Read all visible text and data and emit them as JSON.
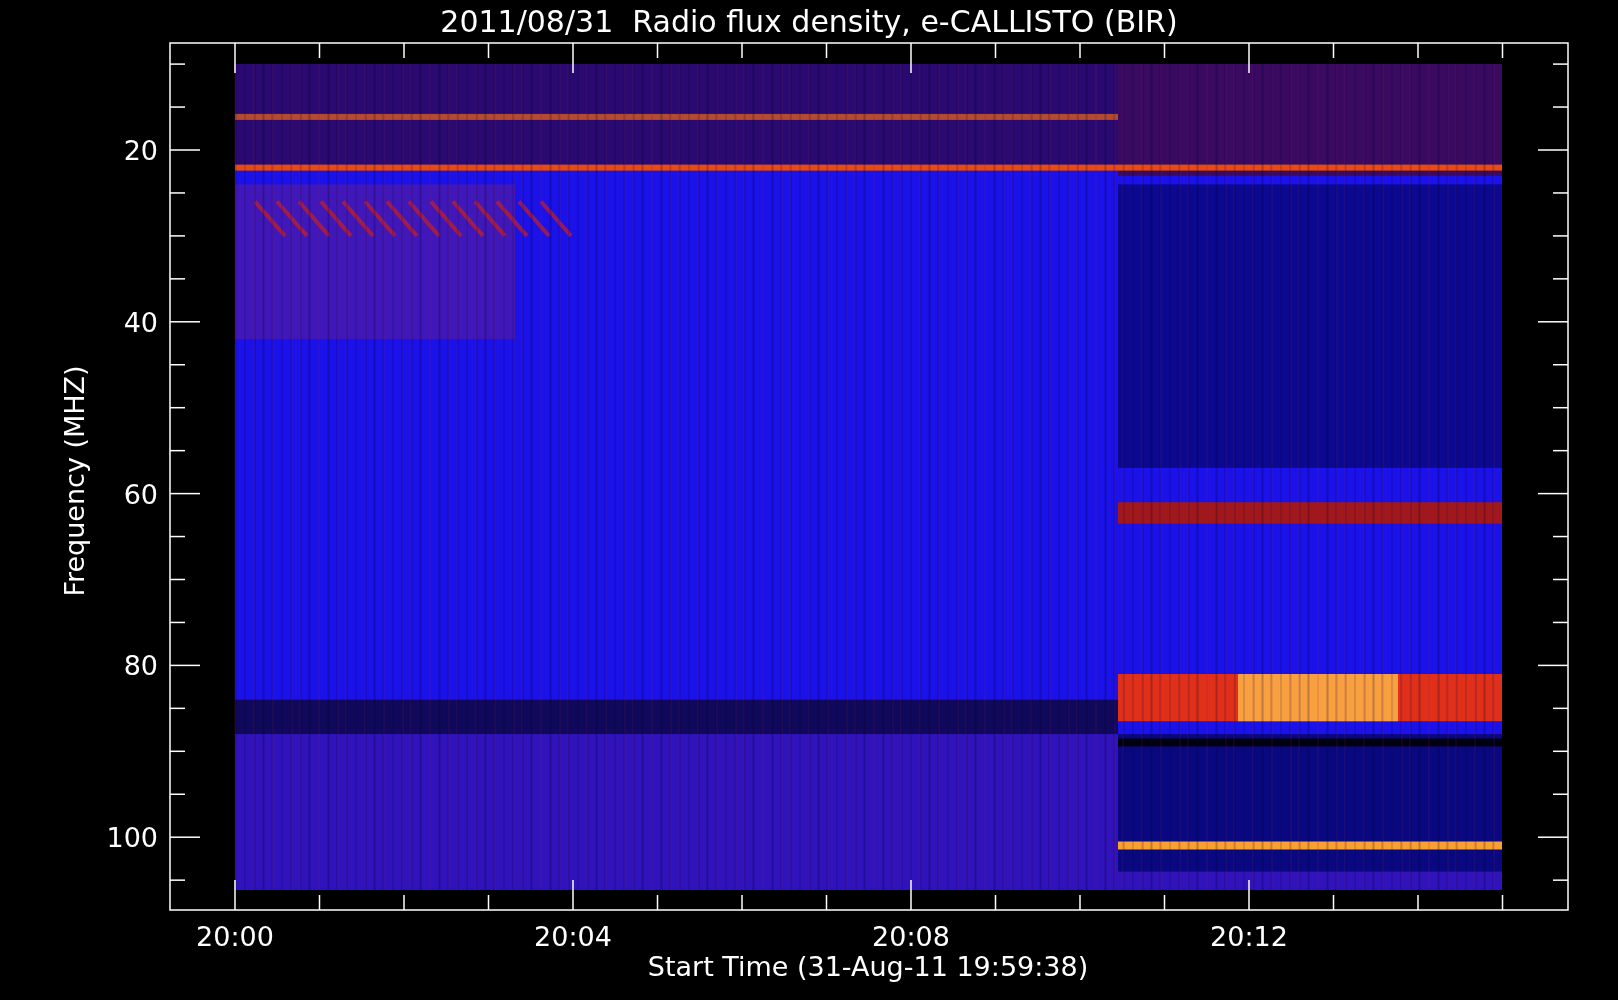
{
  "title": "2011/08/31  Radio flux density, e-CALLISTO (BIR)",
  "y_axis": {
    "label": "Frequency (MHZ)",
    "ticks": [
      "20",
      "40",
      "60",
      "80",
      "100"
    ]
  },
  "x_axis": {
    "label": "Start Time (31-Aug-11 19:59:38)",
    "ticks": [
      "20:00",
      "20:04",
      "20:08",
      "20:12"
    ]
  }
}
